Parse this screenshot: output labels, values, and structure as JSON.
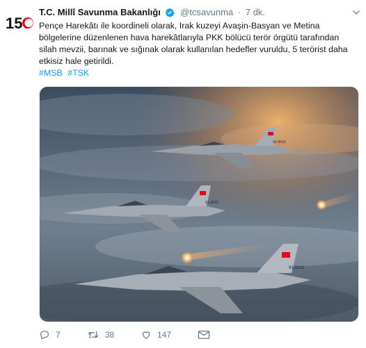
{
  "tweet": {
    "display_name": "T.C. Millî Savunma Bakanlığı",
    "handle": "@tcsavunma",
    "separator": "·",
    "time": "7 dk.",
    "text": "Pençe Harekâtı ile koordineli olarak, Irak kuzeyi Avaşin-Basyan ve Metina bölgelerine düzenlenen hava harekâtlarıyla PKK bölücü terör örgütü tarafından silah mevzii, barınak ve sığınak olarak kullanılan hedefler vuruldu, 5 terörist daha etkisiz hale getirildi.",
    "hashtags": [
      "#MSB",
      "#TSK"
    ],
    "avatar_text": "150"
  },
  "jet_labels": [
    "91-0013",
    "91-0012",
    "91-0013"
  ],
  "actions": {
    "reply_count": "7",
    "retweet_count": "38",
    "like_count": "147"
  },
  "icons": {
    "verified": "verified-badge-icon",
    "menu": "chevron-down-icon",
    "reply": "reply-icon",
    "retweet": "retweet-icon",
    "like": "heart-icon",
    "dm": "envelope-icon"
  },
  "colors": {
    "link": "#1b95e0",
    "muted": "#657786",
    "verified": "#1da1f2",
    "flag_red": "#e30a17"
  }
}
